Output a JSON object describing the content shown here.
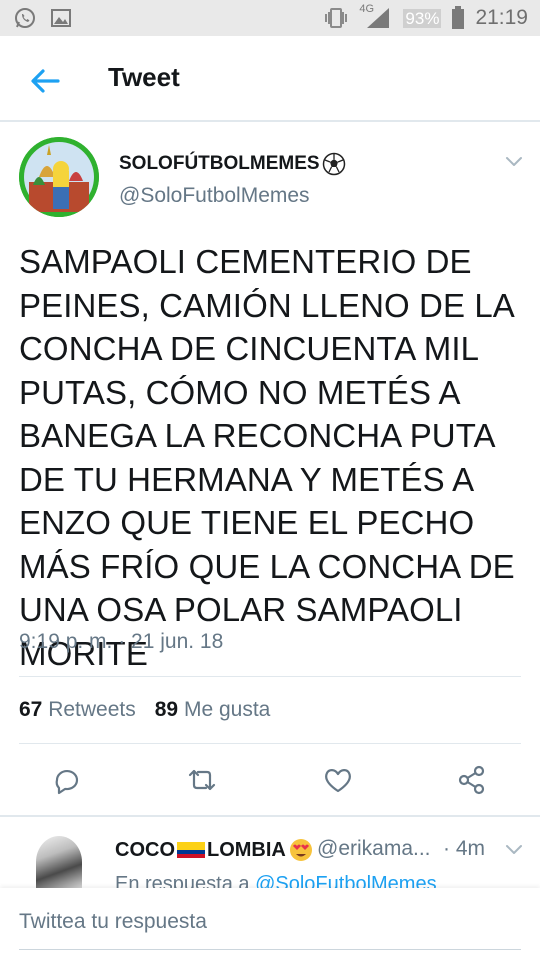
{
  "status_bar": {
    "network": "4G",
    "battery": "93%",
    "time": "21:19",
    "icons": [
      "whatsapp-icon",
      "gallery-icon",
      "vibrate-icon",
      "signal-icon",
      "battery-icon"
    ]
  },
  "header": {
    "title": "Tweet"
  },
  "tweet": {
    "author_name": "SOLOFÚTBOLMEMES",
    "author_handle": "@SoloFutbolMemes",
    "text": "SAMPAOLI CEMENTERIO DE PEINES, CAMIÓN LLENO DE LA CONCHA DE CINCUENTA MIL PUTAS, CÓMO NO METÉS A BANEGA LA RECONCHA PUTA DE TU HERMANA Y METÉS A ENZO QUE TIENE EL PECHO MÁS FRÍO QUE LA CONCHA DE UNA OSA POLAR SAMPAOLI MORITE",
    "date": "9:19 p. m. · 21 jun. 18",
    "retweets_count": "67",
    "retweets_label": "Retweets",
    "likes_count": "89",
    "likes_label": "Me gusta"
  },
  "reply": {
    "name_part1": "COCO",
    "name_part2": "LOMBIA",
    "handle": "@erikama...",
    "time": "· 4m",
    "in_reply_prefix": "En respuesta a",
    "in_reply_handle": "@SoloFutbolMemes"
  },
  "compose": {
    "placeholder": "Twittea tu respuesta"
  },
  "colors": {
    "accent": "#1da1f2",
    "secondary_text": "#657786",
    "divider": "#e1e8ed",
    "avatar_ring": "#2fb12f"
  }
}
